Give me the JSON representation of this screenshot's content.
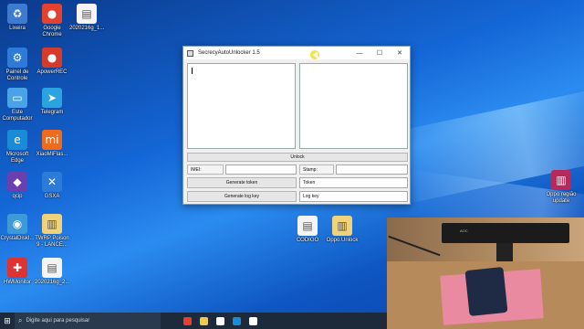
{
  "desktop": {
    "icons": [
      {
        "label": "Lixeira",
        "glyph": "♻",
        "color": "#3d7bd1",
        "name": "recycle-bin-icon"
      },
      {
        "label": "Google Chrome",
        "glyph": "●",
        "color": "#e5412f",
        "name": "chrome-icon"
      },
      {
        "label": "2020216g_1...",
        "glyph": "▤",
        "color": "#f4f4f4",
        "name": "document-icon"
      },
      {
        "label": "Painel de Controle",
        "glyph": "⚙",
        "color": "#2e7ad9",
        "name": "control-panel-icon"
      },
      {
        "label": "ApowerREC",
        "glyph": "●",
        "color": "#d63a2a",
        "name": "apowerrec-icon"
      },
      {
        "label": "Este Computador",
        "glyph": "▭",
        "color": "#4aa3e6",
        "name": "computer-icon"
      },
      {
        "label": "Telegram",
        "glyph": "➤",
        "color": "#2aa3e0",
        "name": "telegram-icon"
      },
      {
        "label": "Microsoft Edge",
        "glyph": "e",
        "color": "#1a8bd6",
        "name": "edge-icon"
      },
      {
        "label": "XiaoMiFlas...",
        "glyph": "mi",
        "color": "#f06a1c",
        "name": "xiaomi-flash-icon"
      },
      {
        "label": "qcip",
        "glyph": "◆",
        "color": "#6b3fb0",
        "name": "qcip-icon"
      },
      {
        "label": "GSXA",
        "glyph": "✕",
        "color": "#2d7bd8",
        "name": "gsxa-icon"
      },
      {
        "label": "CrystalDiskI...",
        "glyph": "◉",
        "color": "#3c9ad6",
        "name": "crystaldisk-icon"
      },
      {
        "label": "TWRP Poison 9 - LANCE...",
        "glyph": "▥",
        "color": "#f0d27a",
        "name": "zip-folder-icon"
      },
      {
        "label": "HWMonitor",
        "glyph": "✚",
        "color": "#d33",
        "name": "hwmonitor-icon"
      },
      {
        "label": "2020216g_2...",
        "glyph": "▤",
        "color": "#f4f4f4",
        "name": "document-icon"
      },
      {
        "label": "CODIGO",
        "glyph": "▤",
        "color": "#f4f4f4",
        "name": "document-icon"
      },
      {
        "label": "Oppo.Unlock",
        "glyph": "▥",
        "color": "#f0d27a",
        "name": "zip-folder-icon"
      },
      {
        "label": "Oppo região update",
        "glyph": "▥",
        "color": "#b52a5a",
        "name": "winrar-icon"
      }
    ]
  },
  "window": {
    "title": "SecrecyAutoUnlocker 1.5",
    "minimize": "—",
    "maximize": "☐",
    "close": "✕",
    "unlock_button": "Unlock",
    "imei_label": "IMEI:",
    "imei_value": "",
    "stamp_label": "Stamp:",
    "stamp_value": "",
    "generate_token_button": "Generate token",
    "token_field": "Token",
    "generate_log_key_button": "Generate log key",
    "log_key_field": "Log key"
  },
  "webcam": {
    "monitor_brand": "AOC"
  },
  "taskbar": {
    "start_glyph": "⊞",
    "search_placeholder": "Digite aqui para pesquisar",
    "search_glyph": "⌕",
    "apps": [
      {
        "name": "chrome-taskbar-icon",
        "color": "#e5412f"
      },
      {
        "name": "file-explorer-taskbar-icon",
        "color": "#f2c84b"
      },
      {
        "name": "calendar-taskbar-icon",
        "color": "#ffffff"
      },
      {
        "name": "edge-taskbar-icon",
        "color": "#1a8bd6"
      },
      {
        "name": "app-taskbar-icon",
        "color": "#ffffff"
      }
    ]
  }
}
